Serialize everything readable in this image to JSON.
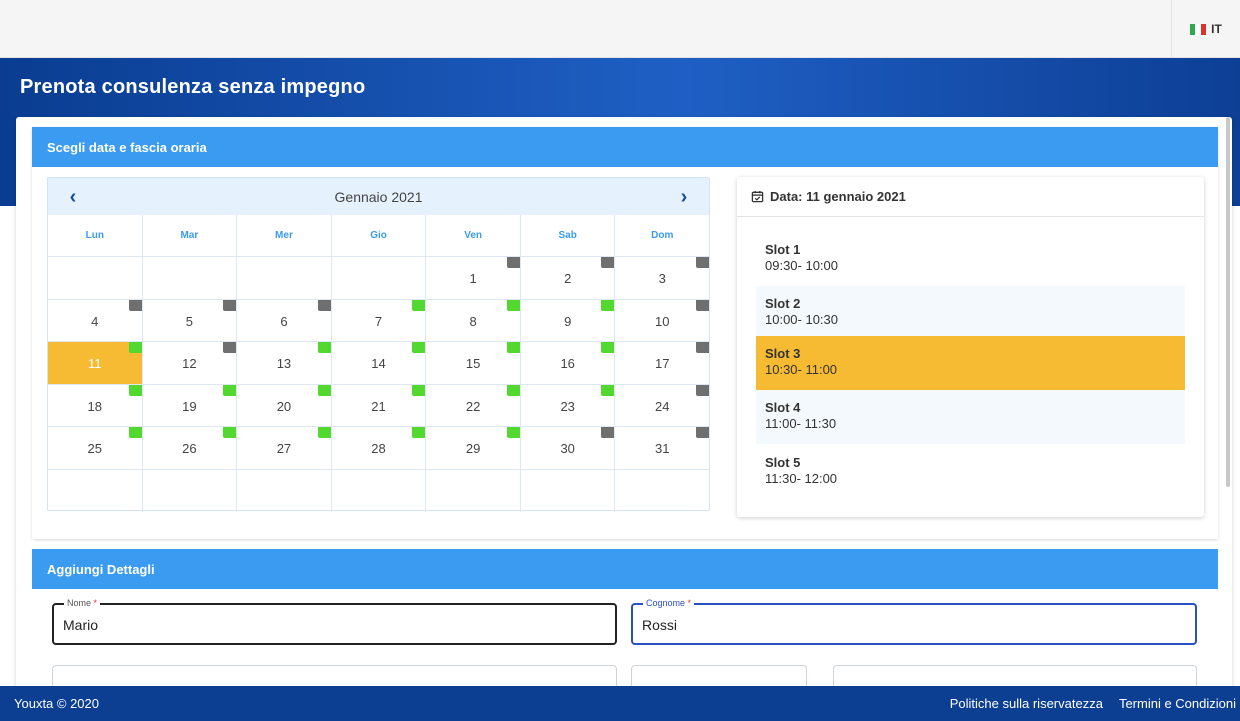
{
  "language": {
    "code": "IT",
    "flag_colors": [
      "#2fa84f",
      "#ffffff",
      "#d8342c"
    ]
  },
  "page_title": "Prenota consulenza senza impegno",
  "section_date": {
    "title": "Scegli data e fascia oraria"
  },
  "calendar": {
    "month_label": "Gennaio 2021",
    "weekdays": [
      "Lun",
      "Mar",
      "Mer",
      "Gio",
      "Ven",
      "Sab",
      "Dom"
    ],
    "weeks": [
      [
        {
          "d": ""
        },
        {
          "d": ""
        },
        {
          "d": ""
        },
        {
          "d": ""
        },
        {
          "d": "1",
          "s": "gray"
        },
        {
          "d": "2",
          "s": "gray"
        },
        {
          "d": "3",
          "s": "gray"
        }
      ],
      [
        {
          "d": "4",
          "s": "gray"
        },
        {
          "d": "5",
          "s": "gray"
        },
        {
          "d": "6",
          "s": "gray"
        },
        {
          "d": "7",
          "s": "green"
        },
        {
          "d": "8",
          "s": "green"
        },
        {
          "d": "9",
          "s": "green"
        },
        {
          "d": "10",
          "s": "gray"
        }
      ],
      [
        {
          "d": "11",
          "s": "green",
          "selected": true
        },
        {
          "d": "12",
          "s": "gray"
        },
        {
          "d": "13",
          "s": "green"
        },
        {
          "d": "14",
          "s": "green"
        },
        {
          "d": "15",
          "s": "green"
        },
        {
          "d": "16",
          "s": "green"
        },
        {
          "d": "17",
          "s": "gray"
        }
      ],
      [
        {
          "d": "18",
          "s": "green"
        },
        {
          "d": "19",
          "s": "green"
        },
        {
          "d": "20",
          "s": "green"
        },
        {
          "d": "21",
          "s": "green"
        },
        {
          "d": "22",
          "s": "green"
        },
        {
          "d": "23",
          "s": "green"
        },
        {
          "d": "24",
          "s": "gray"
        }
      ],
      [
        {
          "d": "25",
          "s": "green"
        },
        {
          "d": "26",
          "s": "green"
        },
        {
          "d": "27",
          "s": "green"
        },
        {
          "d": "28",
          "s": "green"
        },
        {
          "d": "29",
          "s": "green"
        },
        {
          "d": "30",
          "s": "gray"
        },
        {
          "d": "31",
          "s": "gray"
        }
      ],
      [
        {
          "d": ""
        },
        {
          "d": ""
        },
        {
          "d": ""
        },
        {
          "d": ""
        },
        {
          "d": ""
        },
        {
          "d": ""
        },
        {
          "d": ""
        }
      ]
    ],
    "status_colors": {
      "green": "#52d82f",
      "gray": "#6f6f6f"
    },
    "selected_color": "#f6bb32"
  },
  "slots_panel": {
    "date_label": "Data: 11 gennaio 2021",
    "slots": [
      {
        "name": "Slot 1",
        "time": "09:30- 10:00",
        "state": "normal"
      },
      {
        "name": "Slot 2",
        "time": "10:00- 10:30",
        "state": "alt"
      },
      {
        "name": "Slot 3",
        "time": "10:30- 11:00",
        "state": "selected"
      },
      {
        "name": "Slot 4",
        "time": "11:00- 11:30",
        "state": "alt"
      },
      {
        "name": "Slot 5",
        "time": "11:30- 12:00",
        "state": "normal"
      }
    ]
  },
  "section_details": {
    "title": "Aggiungi Dettagli",
    "nome": {
      "label": "Nome",
      "required_mark": "*",
      "value": "Mario"
    },
    "cognome": {
      "label": "Cognome",
      "required_mark": "*",
      "value": "Rossi"
    }
  },
  "footer": {
    "copyright": "Youxta © 2020",
    "privacy_link": "Politiche sulla riservatezza",
    "terms_link": "Termini e Condizioni"
  },
  "colors": {
    "section_header": "#3a9bf0",
    "hero_blue": "#0a3d91",
    "footer_blue": "#0c3f92"
  }
}
